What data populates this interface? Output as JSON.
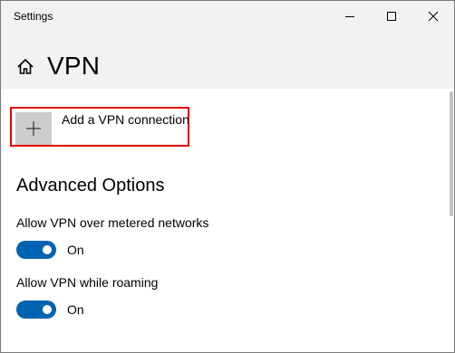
{
  "window": {
    "title": "Settings"
  },
  "header": {
    "title": "VPN"
  },
  "add_vpn": {
    "label": "Add a VPN connection"
  },
  "advanced": {
    "heading": "Advanced Options",
    "options": [
      {
        "label": "Allow VPN over metered networks",
        "state": "On",
        "enabled": true
      },
      {
        "label": "Allow VPN while roaming",
        "state": "On",
        "enabled": true
      }
    ]
  },
  "colors": {
    "accent": "#0063b1",
    "highlight": "#e00000"
  }
}
